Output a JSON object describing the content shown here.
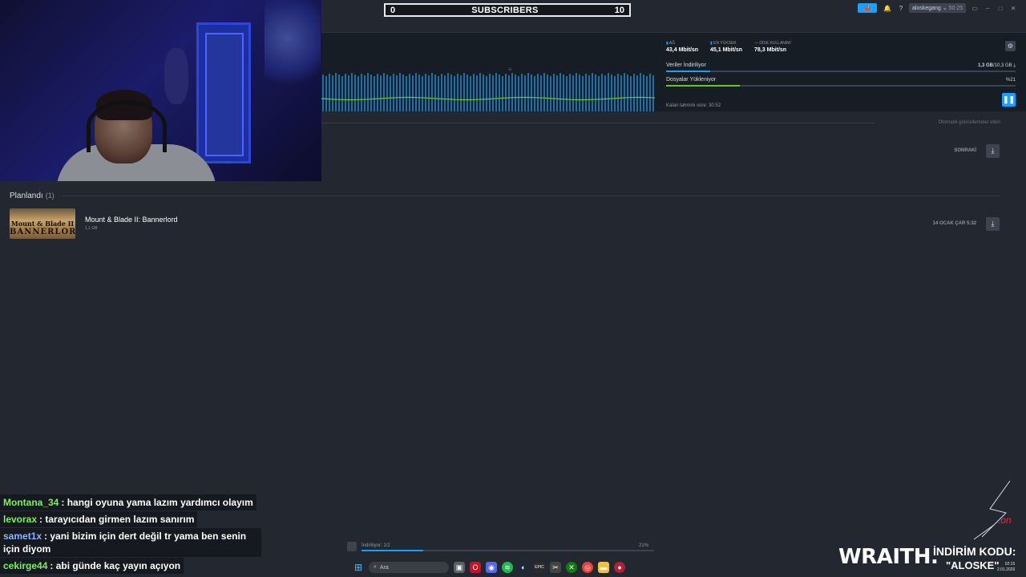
{
  "subscriber_bar": {
    "left_count": "0",
    "label": "SUBSCRIBERS",
    "right_count": "10"
  },
  "topbar": {
    "announce_icon": "megaphone-icon",
    "notification_icon": "bell-icon",
    "help_label": "?",
    "username": "aloskegang",
    "wallet": "50 25"
  },
  "graph": {
    "network_label": "AĞ",
    "network_value": "43,4 Mbit/sn",
    "peak_label": "EN YÜKSEK",
    "peak_value": "45,1 Mbit/sn",
    "disk_label": "DİSK KULLANIMI",
    "disk_value": "78,3 Mbit/sn",
    "download_label": "Veriler İndiriliyor",
    "download_amount": "1,3 GB",
    "download_total": "/10,3 GB",
    "download_fraction": 0.126,
    "install_label": "Dosyalar Yükleniyor",
    "install_percent": "%21",
    "install_fraction": 0.21,
    "eta": "Kalan tahmini süre: 30:52"
  },
  "list": {
    "auto_updates": "Otomatik güncellemeler etkin",
    "next_label": "SONRAKİ",
    "planned_header": "Planlandı",
    "planned_count": "(1)",
    "game": {
      "title": "Mount & Blade II: Bannerlord",
      "size": "1,1 GB",
      "thumb_line1": "Mount & Blade II",
      "thumb_line2": "BANNERLORD",
      "scheduled": "14 OCAK ÇAR 5:32"
    }
  },
  "chat": [
    {
      "user": "Montana_34",
      "color": "#7cf05b",
      "message": ": hangi oyuna yama lazım yardımcı olayım"
    },
    {
      "user": "levorax",
      "color": "#7cf05b",
      "message": ": tarayıcıdan girmen lazım sanırım"
    },
    {
      "user": "samet1x",
      "color": "#8ab4ff",
      "message": ": yani bizim için dert değil tr yama ben senin için diyom"
    },
    {
      "user": "cekirge44",
      "color": "#7cf05b",
      "message": ": abi günde kaç yayın açıyon"
    }
  ],
  "status_bar": {
    "text": "İndiriliyor: 1/2",
    "percent": "21%",
    "fraction": 0.21
  },
  "taskbar": {
    "search_placeholder": "Ara"
  },
  "sponsor": {
    "brand": "WRAITH.",
    "code_title": "İNDİRİM KODU:",
    "code_value": "\"ALOSKE\""
  },
  "clock": {
    "time": "02:15",
    "date": "2.01.2026"
  },
  "colors": {
    "accent": "#1a9fff",
    "background": "#23272f",
    "panel": "#171d25",
    "graph_line": "#69c42d"
  }
}
